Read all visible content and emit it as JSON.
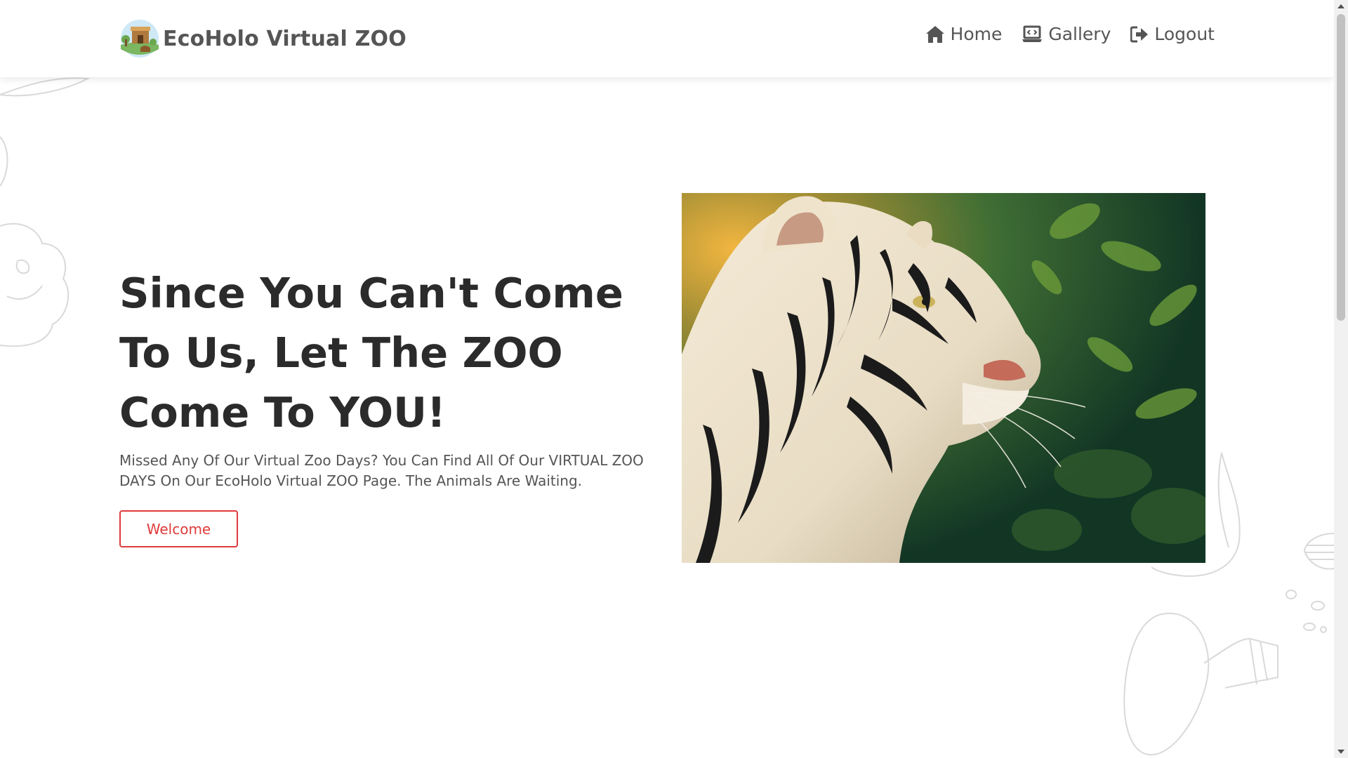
{
  "brand": {
    "title": "EcoHolo Virtual ZOO",
    "logo_icon": "zoo-logo-icon"
  },
  "nav": [
    {
      "label": "Home",
      "icon": "home-icon"
    },
    {
      "label": "Gallery",
      "icon": "gallery-icon"
    },
    {
      "label": "Logout",
      "icon": "logout-icon"
    }
  ],
  "hero": {
    "title": "Since You Can't Come To Us, Let The ZOO Come To YOU!",
    "text": "Missed Any Of Our Virtual Zoo Days? You Can Find All Of Our VIRTUAL ZOO DAYS On Our EcoHolo Virtual ZOO Page. The Animals Are Waiting.",
    "button_label": "Welcome",
    "image_icon": "white-tiger-image"
  },
  "colors": {
    "accent": "#e03a3a",
    "title": "#2b2b2b",
    "text": "#555555",
    "nav": "#555555"
  }
}
